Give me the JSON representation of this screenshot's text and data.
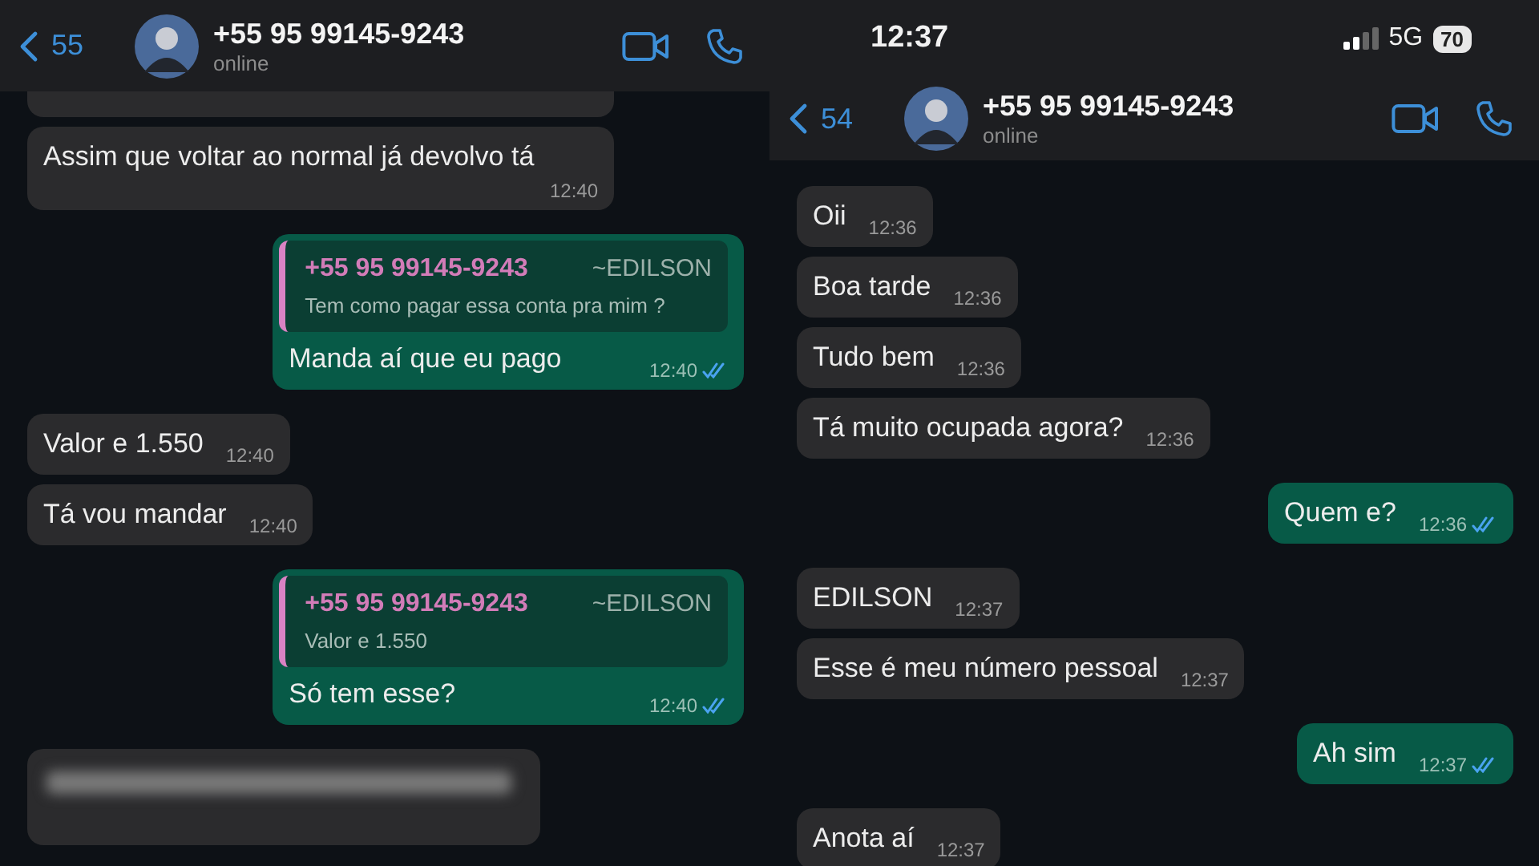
{
  "chats": [
    {
      "header": {
        "back_count": "55",
        "contact": "+55 95 99145-9243",
        "status": "online"
      },
      "messages": [
        {
          "kind": "cut"
        },
        {
          "kind": "incoming",
          "text": "Assim que voltar ao normal já devolvo tá",
          "time": "12:40"
        },
        {
          "kind": "outgoing",
          "text": "Manda aí que eu pago",
          "time": "12:40",
          "read": true,
          "quote": {
            "author": "+55 95 99145-9243",
            "tag": "~EDILSON",
            "text": "Tem como pagar essa conta pra mim ?"
          }
        },
        {
          "kind": "incoming",
          "text": "Valor e 1.550",
          "time": "12:40"
        },
        {
          "kind": "incoming",
          "text": "Tá vou mandar",
          "time": "12:40"
        },
        {
          "kind": "outgoing",
          "text": "Só tem esse?",
          "time": "12:40",
          "read": true,
          "quote": {
            "author": "+55 95 99145-9243",
            "tag": "~EDILSON",
            "text": "Valor e 1.550"
          }
        },
        {
          "kind": "blurred"
        }
      ]
    },
    {
      "status_bar": {
        "time": "12:37",
        "network": "5G",
        "battery": "70"
      },
      "header": {
        "back_count": "54",
        "contact": "+55 95 99145-9243",
        "status": "online"
      },
      "messages": [
        {
          "kind": "incoming",
          "text": "Oii",
          "time": "12:36"
        },
        {
          "kind": "incoming",
          "text": "Boa tarde",
          "time": "12:36"
        },
        {
          "kind": "incoming",
          "text": "Tudo bem",
          "time": "12:36"
        },
        {
          "kind": "incoming",
          "text": "Tá muito ocupada agora?",
          "time": "12:36"
        },
        {
          "kind": "outgoing",
          "text": "Quem e?",
          "time": "12:36",
          "read": true
        },
        {
          "kind": "incoming",
          "text": "EDILSON",
          "time": "12:37"
        },
        {
          "kind": "incoming",
          "text": "Esse é meu número pessoal",
          "time": "12:37"
        },
        {
          "kind": "outgoing",
          "text": "Ah sim",
          "time": "12:37",
          "read": true
        },
        {
          "kind": "incoming",
          "text": "Anota aí",
          "time": "12:37"
        }
      ]
    }
  ]
}
